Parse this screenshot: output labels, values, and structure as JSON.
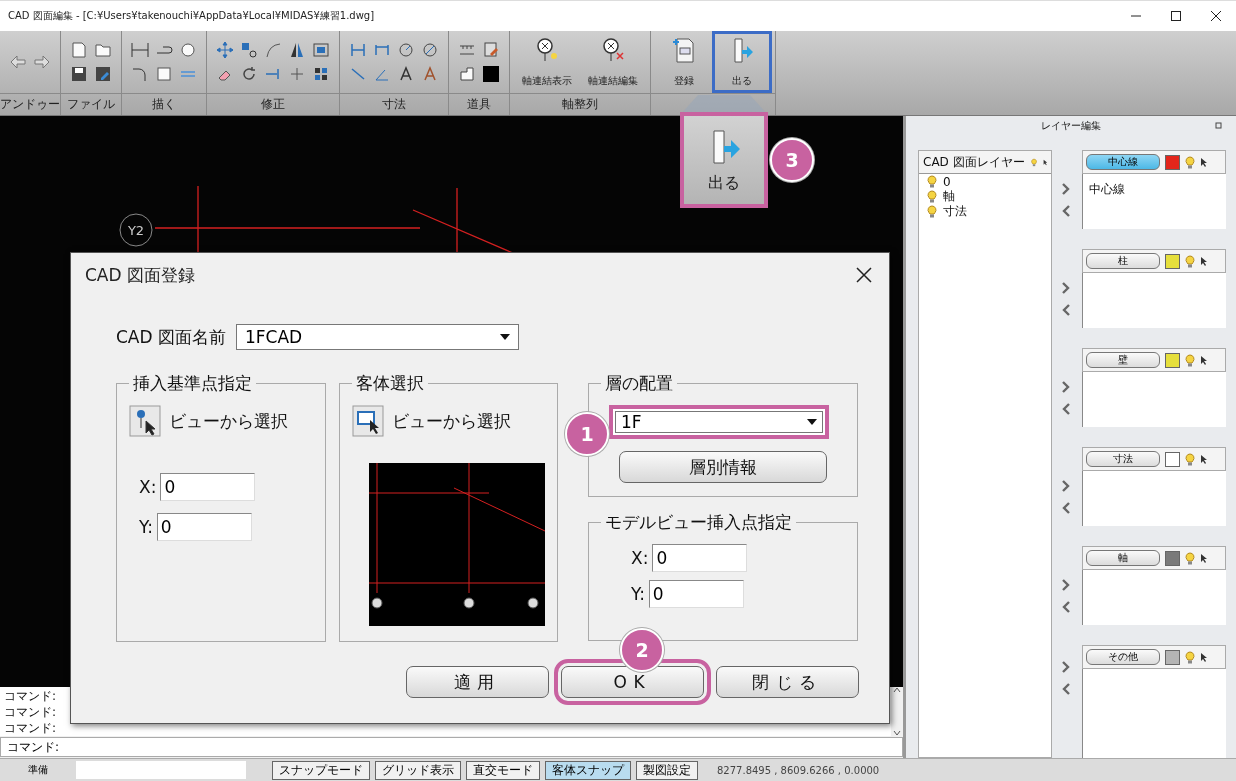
{
  "window": {
    "title": "CAD 図面編集 - [C:¥Users¥takenouchi¥AppData¥Local¥MIDAS¥練習1.dwg]"
  },
  "ribbon": {
    "groups": [
      {
        "label": "アンドゥー",
        "buttons": [
          {
            "kind": "undo"
          },
          {
            "kind": "redo"
          }
        ]
      },
      {
        "label": "ファイル",
        "buttons": [
          {
            "kind": "new"
          },
          {
            "kind": "open"
          },
          {
            "kind": "save"
          },
          {
            "kind": "saveas"
          }
        ]
      },
      {
        "label": "描く",
        "buttons": [
          {
            "kind": "line"
          },
          {
            "kind": "polyline"
          },
          {
            "kind": "circle"
          },
          {
            "kind": "fillet"
          },
          {
            "kind": "rect"
          },
          {
            "kind": "double"
          }
        ]
      },
      {
        "label": "修正",
        "buttons": [
          {
            "kind": "move"
          },
          {
            "kind": "copy"
          },
          {
            "kind": "arc"
          },
          {
            "kind": "mirror"
          },
          {
            "kind": "offset"
          },
          {
            "kind": "erase"
          },
          {
            "kind": "rotate"
          },
          {
            "kind": "extend"
          },
          {
            "kind": "trim"
          },
          {
            "kind": "array"
          }
        ]
      },
      {
        "label": "寸法",
        "buttons": [
          {
            "kind": "dimlinear"
          },
          {
            "kind": "dimwidth"
          },
          {
            "kind": "dimradius"
          },
          {
            "kind": "dimdiameter"
          },
          {
            "kind": "dimaligned"
          },
          {
            "kind": "dimangle"
          },
          {
            "kind": "textstyle"
          },
          {
            "kind": "textcolor"
          }
        ]
      },
      {
        "label": "道具",
        "buttons": [
          {
            "kind": "measure"
          },
          {
            "kind": "props"
          },
          {
            "kind": "frame"
          },
          {
            "kind": "color"
          }
        ]
      },
      {
        "label": "軸整列",
        "buttons": [
          {
            "kind": "axisshow",
            "label": "軸連結表示",
            "highlighted": false
          },
          {
            "kind": "axisedit",
            "label": "軸連結編集",
            "highlighted": false
          }
        ]
      },
      {
        "buttons": [
          {
            "kind": "register",
            "label": "登録",
            "highlighted": false
          },
          {
            "kind": "exit",
            "label": "出る",
            "highlighted": true
          }
        ]
      }
    ]
  },
  "canvas": {
    "axis_label": "Y2"
  },
  "command_log": [
    "コマンド:",
    "コマンド:",
    "コマンド:"
  ],
  "command_prompt": "コマンド:",
  "layer_panel": {
    "title": "レイヤー編集",
    "cad_layers": {
      "title": "CAD 図面レイヤー",
      "items": [
        "0",
        "軸",
        "寸法"
      ]
    },
    "target_layers": [
      {
        "name": "中心線",
        "selected": true,
        "color": "#e3261b",
        "items": [
          "中心線"
        ]
      },
      {
        "name": "柱",
        "selected": false,
        "color": "#e6df3c"
      },
      {
        "name": "壁",
        "selected": false,
        "color": "#e6df3c"
      },
      {
        "name": "寸法",
        "selected": false,
        "color": "#ffffff"
      },
      {
        "name": "軸",
        "selected": false,
        "color": "#7a7a7a"
      },
      {
        "name": "その他",
        "selected": false,
        "color": "#b4b4b4"
      }
    ]
  },
  "status_bar": {
    "text": "準備",
    "toggles": [
      {
        "label": "スナップモード",
        "on": false
      },
      {
        "label": "グリッド表示",
        "on": false
      },
      {
        "label": "直交モード",
        "on": false
      },
      {
        "label": "客体スナップ",
        "on": true
      },
      {
        "label": "製図設定",
        "on": false
      }
    ],
    "coordinates": "8277.8495 , 8609.6266 , 0.0000"
  },
  "dialog": {
    "title": "CAD 図面登録",
    "drawing_name": {
      "label": "CAD 図面名前",
      "value": "1FCAD"
    },
    "insert_base": {
      "title": "挿入基準点指定",
      "button": "ビューから選択",
      "x": {
        "label": "X:",
        "value": "0"
      },
      "y": {
        "label": "Y:",
        "value": "0"
      }
    },
    "object_select": {
      "title": "客体選択",
      "button": "ビューから選択"
    },
    "layer_placement": {
      "title": "層の配置",
      "value": "1F",
      "highlighted": true,
      "button": "層別情報"
    },
    "model_insert": {
      "title": "モデルビュー挿入点指定",
      "x": {
        "label": "X:",
        "value": "0"
      },
      "y": {
        "label": "Y:",
        "value": "0"
      }
    },
    "buttons": [
      {
        "label": "適用",
        "highlighted": false
      },
      {
        "label": "OK",
        "highlighted": true
      },
      {
        "label": "閉じる",
        "highlighted": false
      }
    ]
  },
  "exit_callout": {
    "label": "出る"
  },
  "annotations": [
    {
      "label": "1"
    },
    {
      "label": "2"
    },
    {
      "label": "3"
    }
  ]
}
